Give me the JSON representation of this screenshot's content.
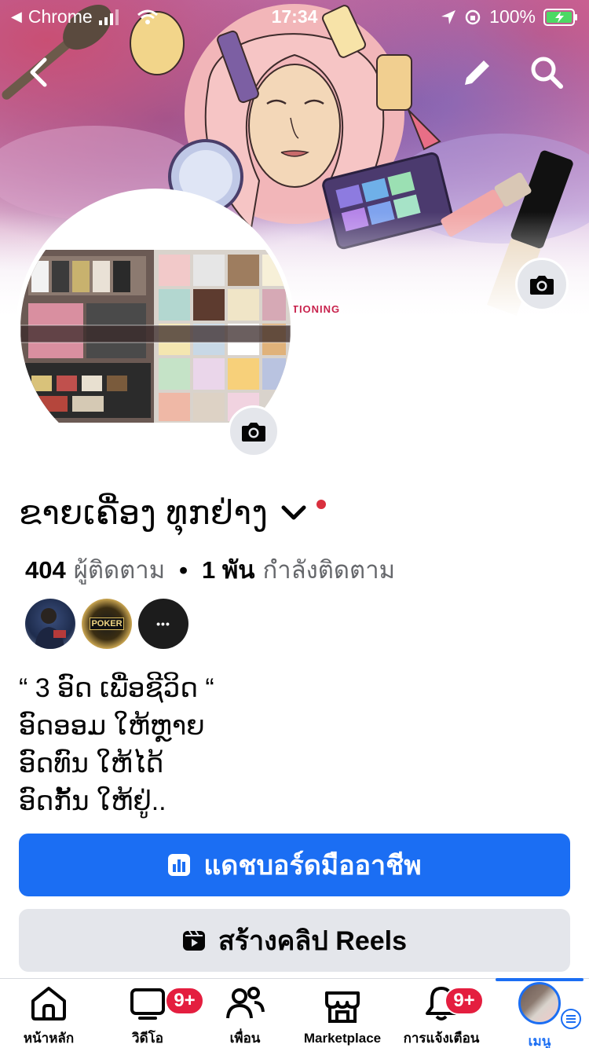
{
  "status_bar": {
    "back_app": "Chrome",
    "time": "17:34",
    "battery": "100%"
  },
  "cover": {
    "watermark": "TIONING"
  },
  "profile": {
    "name": "ຂາຍເຄື່ອງ ທຸກຢ່າງ",
    "followers_count": "404",
    "followers_label": "ผู้ติดตาม",
    "following_count": "1 พัน",
    "following_label": "กำลังติดตาม",
    "separator": "•",
    "more_friends": "•••",
    "friend_badge_text": "POKER",
    "bio_lines": [
      "“ 3 ອົດ ເພື່ອຊີວິດ “",
      "ອົດອອມ ໃຫ້ຫຼາຍ",
      "ອົດທົນ ໃຫ້ໄດ້",
      "ອົດກັ້ນ ໃຫ້ຢູ່.."
    ]
  },
  "buttons": {
    "dashboard": "แดชบอร์ดมืออาชีพ",
    "reels": "สร้างคลิป Reels"
  },
  "tabbar": {
    "items": [
      {
        "label": "หน้าหลัก"
      },
      {
        "label": "วิดีโอ",
        "badge": "9+"
      },
      {
        "label": "เพื่อน"
      },
      {
        "label": "Marketplace"
      },
      {
        "label": "การแจ้งเตือน",
        "badge": "9+"
      },
      {
        "label": "เมนู"
      }
    ]
  },
  "colors": {
    "primary": "#1b6ef3",
    "badge": "#e41e3f",
    "secondary_button": "#e4e6eb"
  }
}
